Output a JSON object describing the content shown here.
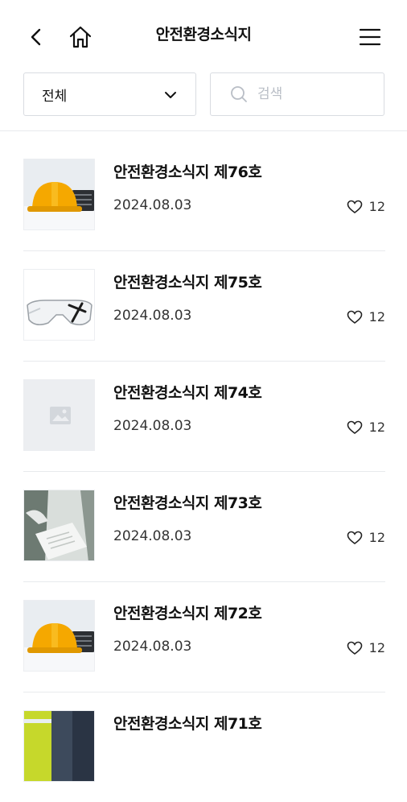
{
  "header": {
    "title": "안전환경소식지",
    "back_icon": "chevron-left-icon",
    "home_icon": "home-icon",
    "menu_icon": "hamburger-menu-icon"
  },
  "filter": {
    "selected": "전체"
  },
  "search": {
    "placeholder": "검색",
    "value": ""
  },
  "items": [
    {
      "title": "안전환경소식지 제76호",
      "date": "2024.08.03",
      "likes": "12",
      "thumb": "helmet"
    },
    {
      "title": "안전환경소식지 제75호",
      "date": "2024.08.03",
      "likes": "12",
      "thumb": "goggles"
    },
    {
      "title": "안전환경소식지 제74호",
      "date": "2024.08.03",
      "likes": "12",
      "thumb": "placeholder"
    },
    {
      "title": "안전환경소식지 제73호",
      "date": "2024.08.03",
      "likes": "12",
      "thumb": "document"
    },
    {
      "title": "안전환경소식지 제72호",
      "date": "2024.08.03",
      "likes": "12",
      "thumb": "helmet"
    },
    {
      "title": "안전환경소식지 제71호",
      "date": "",
      "likes": "",
      "thumb": "worker"
    }
  ],
  "colors": {
    "border": "#d9dce1",
    "divider": "#e8eaed",
    "helmet": "#f5a800",
    "placeholder_bg": "#eceef1"
  }
}
